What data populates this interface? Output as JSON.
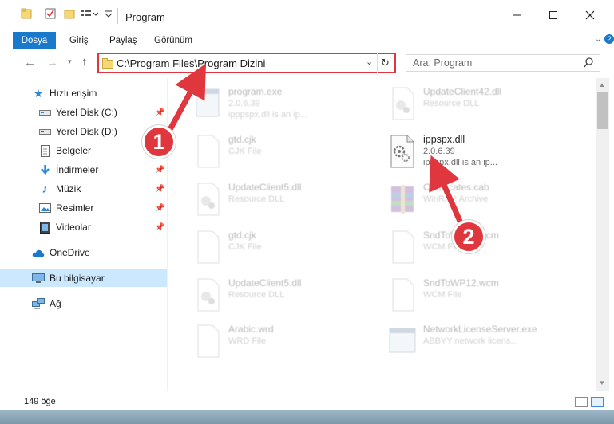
{
  "window": {
    "title": "Program"
  },
  "ribbon": {
    "tabs": [
      "Dosya",
      "Giriş",
      "Paylaş",
      "Görünüm"
    ]
  },
  "address": {
    "path": "C:\\Program Files\\Program Dizini"
  },
  "search": {
    "placeholder": "Ara: Program"
  },
  "sidebar": {
    "items": [
      {
        "label": "Hızlı erişim",
        "icon": "star-icon",
        "pinned": false
      },
      {
        "label": "Yerel Disk (C:)",
        "icon": "drive-icon",
        "pinned": true
      },
      {
        "label": "Yerel Disk (D:)",
        "icon": "drive-icon",
        "pinned": true
      },
      {
        "label": "Belgeler",
        "icon": "documents-icon",
        "pinned": true
      },
      {
        "label": "İndirmeler",
        "icon": "download-icon",
        "pinned": true
      },
      {
        "label": "Müzik",
        "icon": "music-icon",
        "pinned": true
      },
      {
        "label": "Resimler",
        "icon": "pictures-icon",
        "pinned": true
      },
      {
        "label": "Videolar",
        "icon": "video-icon",
        "pinned": true
      },
      {
        "label": "OneDrive",
        "icon": "cloud-icon",
        "pinned": false
      },
      {
        "label": "Bu bilgisayar",
        "icon": "computer-icon",
        "pinned": false
      },
      {
        "label": "Ağ",
        "icon": "network-icon",
        "pinned": false
      }
    ]
  },
  "files": [
    {
      "name": "program.exe",
      "line2": "2.0.6.39",
      "line3": "ipppspx.dll is an ip..."
    },
    {
      "name": "UpdateClient42.dll",
      "line2": "Resource DLL",
      "line3": ""
    },
    {
      "name": "gtd.cjk",
      "line2": "CJK File",
      "line3": ""
    },
    {
      "name": "ippspx.dll",
      "line2": "2.0.6.39",
      "line3": "ippspx.dll is an ip..."
    },
    {
      "name": "UpdateClient5.dll",
      "line2": "Resource DLL",
      "line3": ""
    },
    {
      "name": "Certificates.cab",
      "line2": "WinRAR Archive",
      "line3": ""
    },
    {
      "name": "gtd.cjk",
      "line2": "CJK File",
      "line3": ""
    },
    {
      "name": "SndToWP12.wcm",
      "line2": "WCM File",
      "line3": ""
    },
    {
      "name": "UpdateClient5.dll",
      "line2": "Resource DLL",
      "line3": ""
    },
    {
      "name": "SndToWP12.wcm",
      "line2": "WCM File",
      "line3": ""
    },
    {
      "name": "Arabic.wrd",
      "line2": "WRD File",
      "line3": ""
    },
    {
      "name": "NetworkLicenseServer.exe",
      "line2": "ABBYY network licens...",
      "line3": ""
    }
  ],
  "status": {
    "count": "149 öğe"
  },
  "callouts": [
    "1",
    "2"
  ],
  "colors": {
    "accent": "#1979ca",
    "highlight": "#e0373f",
    "selected": "#cce8ff"
  }
}
